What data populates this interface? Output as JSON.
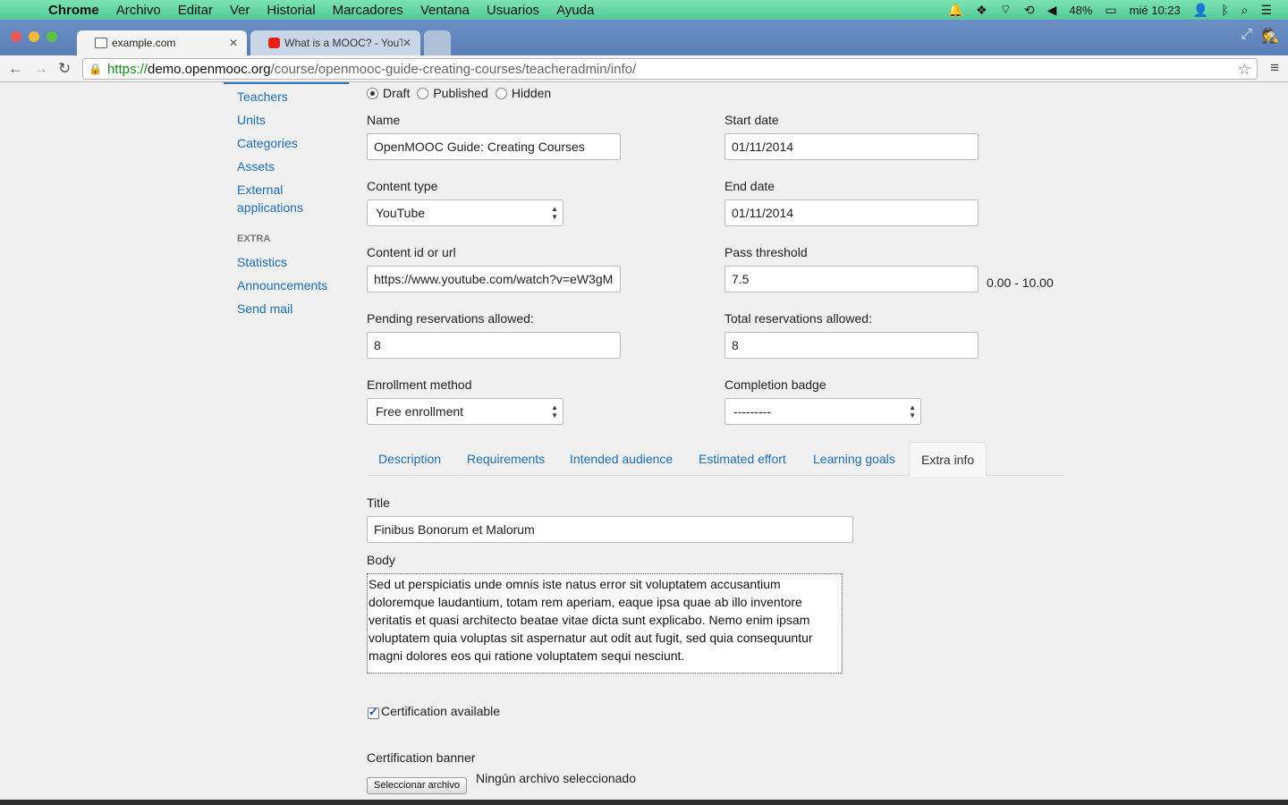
{
  "menubar": {
    "app": "Chrome",
    "items": [
      "Archivo",
      "Editar",
      "Ver",
      "Historial",
      "Marcadores",
      "Ventana",
      "Usuarios",
      "Ayuda"
    ],
    "battery": "48%",
    "clock": "mié 10:23"
  },
  "tabs": [
    {
      "title": "example.com"
    },
    {
      "title": "What is a MOOC? - YouTu"
    }
  ],
  "address": {
    "scheme": "https://",
    "host": "demo.openmooc.org",
    "path": "/course/openmooc-guide-creating-courses/teacheradmin/info/"
  },
  "sidebar": {
    "items": [
      "Teachers",
      "Units",
      "Categories",
      "Assets",
      "External",
      "applications"
    ],
    "extra_header": "EXTRA",
    "extra_items": [
      "Statistics",
      "Announcements",
      "Send mail"
    ]
  },
  "status": {
    "options": [
      "Draft",
      "Published",
      "Hidden"
    ],
    "selected": "Draft"
  },
  "form": {
    "name_label": "Name",
    "name_value": "OpenMOOC Guide: Creating Courses",
    "start_label": "Start date",
    "start_value": "01/11/2014",
    "content_type_label": "Content type",
    "content_type_value": "YouTube",
    "end_label": "End date",
    "end_value": "01/11/2014",
    "content_id_label": "Content id or url",
    "content_id_value": "https://www.youtube.com/watch?v=eW3gM",
    "pass_label": "Pass threshold",
    "pass_value": "7.5",
    "pass_range": "0.00 - 10.00",
    "pending_label": "Pending reservations allowed:",
    "pending_value": "8",
    "total_label": "Total reservations allowed:",
    "total_value": "8",
    "enrollment_label": "Enrollment method",
    "enrollment_value": "Free enrollment",
    "badge_label": "Completion badge",
    "badge_value": "---------"
  },
  "content_tabs": [
    "Description",
    "Requirements",
    "Intended audience",
    "Estimated effort",
    "Learning goals",
    "Extra info"
  ],
  "active_tab": "Extra info",
  "extra": {
    "title_label": "Title",
    "title_value": "Finibus Bonorum et Malorum",
    "body_label": "Body",
    "body_value": "Sed ut perspiciatis unde omnis iste natus error sit voluptatem accusantium doloremque laudantium, totam rem aperiam, eaque ipsa quae ab illo inventore veritatis et quasi architecto beatae vitae dicta sunt explicabo. Nemo enim ipsam voluptatem quia voluptas sit aspernatur aut odit aut fugit, sed quia consequuntur magni dolores eos qui ratione voluptatem sequi nesciunt.",
    "certification_label": "Certification available",
    "certification_checked": true,
    "banner_label": "Certification banner",
    "file_button": "Seleccionar archivo",
    "file_status": "Ningún archivo seleccionado"
  }
}
